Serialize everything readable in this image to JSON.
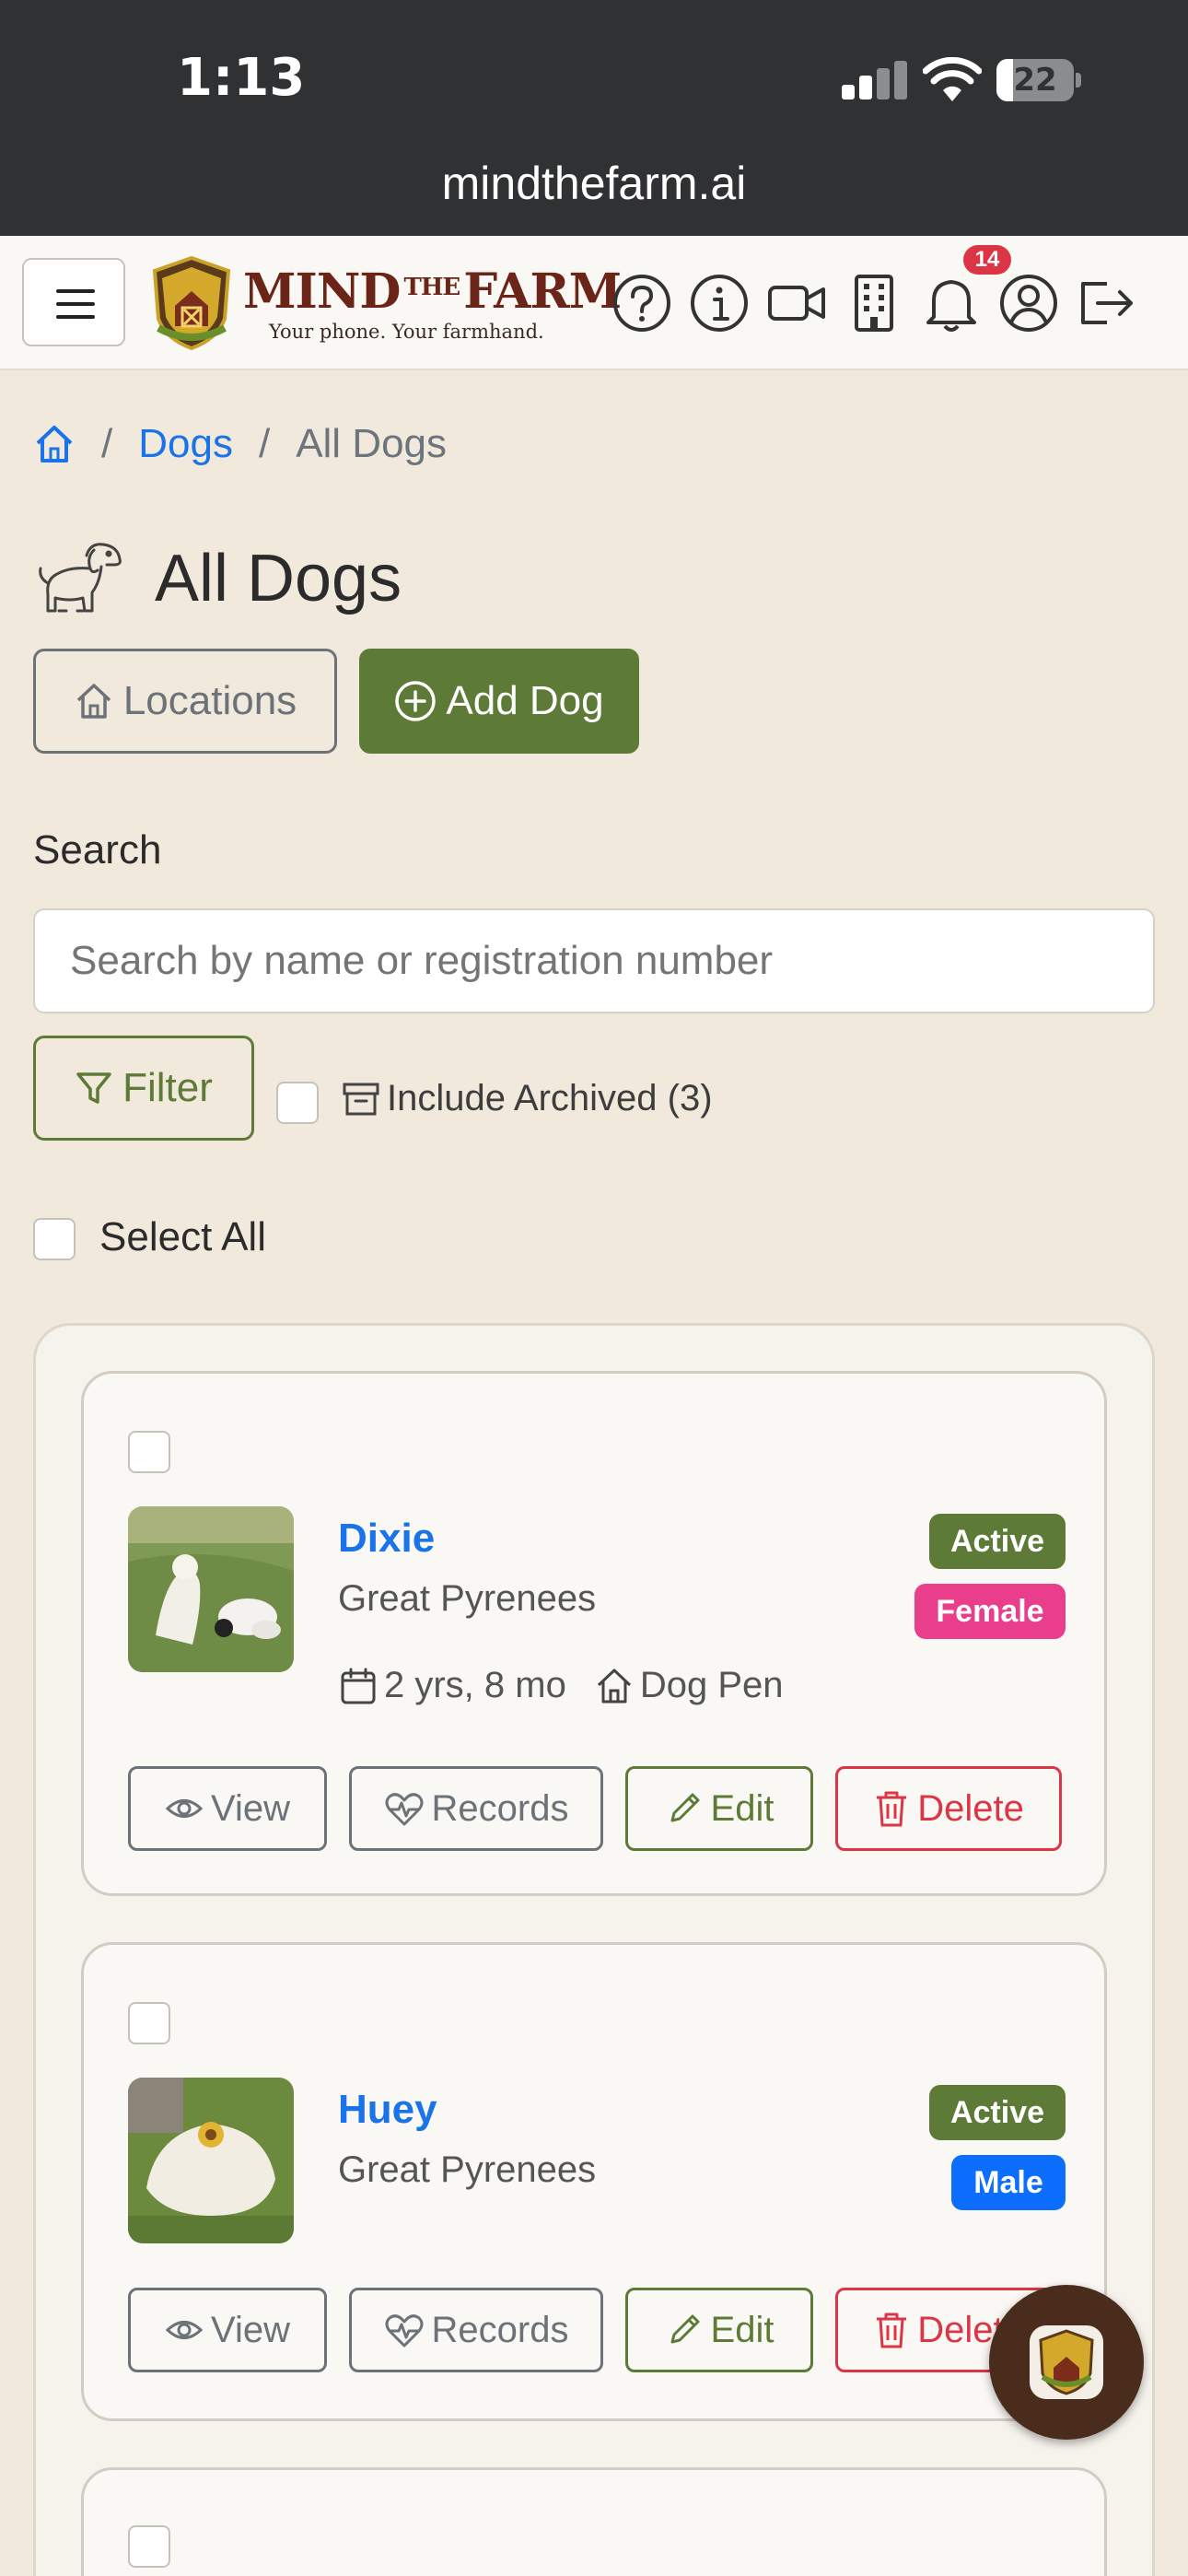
{
  "status_bar": {
    "time": "1:13",
    "battery": "22",
    "battery_level": 0.22
  },
  "browser": {
    "url": "mindthefarm.ai"
  },
  "header": {
    "logo_main_a": "MIND",
    "logo_main_the": "THE",
    "logo_main_b": "FARM",
    "tagline": "Your phone. Your farmhand.",
    "notification_count": "14",
    "icons": [
      "menu-icon",
      "help-icon",
      "info-icon",
      "video-icon",
      "building-icon",
      "bell-icon",
      "user-icon",
      "logout-icon"
    ]
  },
  "breadcrumb": {
    "home_icon": "home-icon",
    "dogs": "Dogs",
    "sep": "/",
    "current": "All Dogs"
  },
  "page": {
    "title": "All Dogs",
    "title_icon": "dog-icon"
  },
  "actions": {
    "locations": "Locations",
    "add_dog": "Add Dog"
  },
  "search": {
    "label": "Search",
    "placeholder": "Search by name or registration number"
  },
  "filters": {
    "filter": "Filter",
    "include_archived": "Include Archived (3)",
    "select_all": "Select All"
  },
  "dogs": [
    {
      "name": "Dixie",
      "breed": "Great Pyrenees",
      "status": "Active",
      "sex": "Female",
      "age": "2 yrs, 8 mo",
      "location": "Dog Pen"
    },
    {
      "name": "Huey",
      "breed": "Great Pyrenees",
      "status": "Active",
      "sex": "Male"
    }
  ],
  "card_actions": {
    "view": "View",
    "records": "Records",
    "edit": "Edit",
    "delete": "Delete"
  },
  "colors": {
    "primary_green": "#5d7a37",
    "link_blue": "#1a73e8",
    "female": "#e83e8c",
    "male": "#0d6efd",
    "danger": "#dc3545"
  }
}
